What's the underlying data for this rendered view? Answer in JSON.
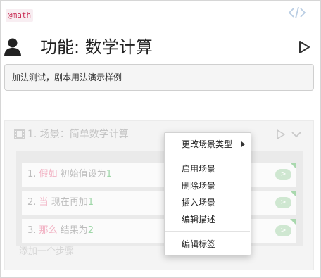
{
  "header": {
    "tag": "@math",
    "feature_title": "功能: 数学计算",
    "description": "加法测试，剧本用法演示样例"
  },
  "scenario": {
    "title": "1. 场景：简单数学计算",
    "steps": [
      {
        "index": "1.",
        "keyword": "假如",
        "text": "初始值设为",
        "value": "1",
        "button": ">"
      },
      {
        "index": "2.",
        "keyword": "当",
        "text": "现在再加",
        "value": "1",
        "button": ">"
      },
      {
        "index": "3.",
        "keyword": "那么",
        "text": "结果为",
        "value": "2",
        "button": ">"
      }
    ],
    "add_step": "添加一个步骤"
  },
  "context_menu": {
    "change_type": "更改场景类型",
    "enable": "启用场景",
    "delete": "删除场景",
    "insert": "插入场景",
    "edit_desc": "编辑描述",
    "edit_tags": "编辑标签"
  }
}
